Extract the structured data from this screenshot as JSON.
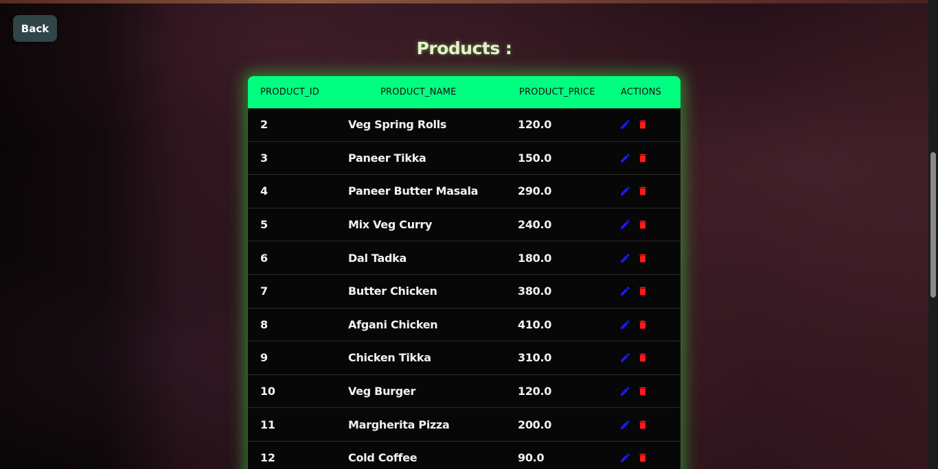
{
  "back_button": {
    "label": "Back"
  },
  "page": {
    "title": "Products :"
  },
  "table": {
    "headers": [
      "PRODUCT_ID",
      "PRODUCT_NAME",
      "PRODUCT_PRICE",
      "ACTIONS"
    ],
    "rows": [
      {
        "id": "2",
        "name": "Veg Spring Rolls",
        "price": "120.0"
      },
      {
        "id": "3",
        "name": "Paneer Tikka",
        "price": "150.0"
      },
      {
        "id": "4",
        "name": "Paneer Butter Masala",
        "price": "290.0"
      },
      {
        "id": "5",
        "name": "Mix Veg Curry",
        "price": "240.0"
      },
      {
        "id": "6",
        "name": "Dal Tadka",
        "price": "180.0"
      },
      {
        "id": "7",
        "name": "Butter Chicken",
        "price": "380.0"
      },
      {
        "id": "8",
        "name": "Afgani Chicken",
        "price": "410.0"
      },
      {
        "id": "9",
        "name": "Chicken Tikka",
        "price": "310.0"
      },
      {
        "id": "10",
        "name": "Veg Burger",
        "price": "120.0"
      },
      {
        "id": "11",
        "name": "Margherita Pizza",
        "price": "200.0"
      },
      {
        "id": "12",
        "name": "Cold Coffee",
        "price": "90.0"
      }
    ],
    "actions": {
      "edit_icon": "pencil-icon",
      "delete_icon": "trash-icon"
    }
  },
  "colors": {
    "header_background": "#00ff80",
    "edit_icon": "#1a1aff",
    "delete_icon": "#ff1a1a",
    "back_button": "#2f4548",
    "glow": "#3cc83c"
  }
}
